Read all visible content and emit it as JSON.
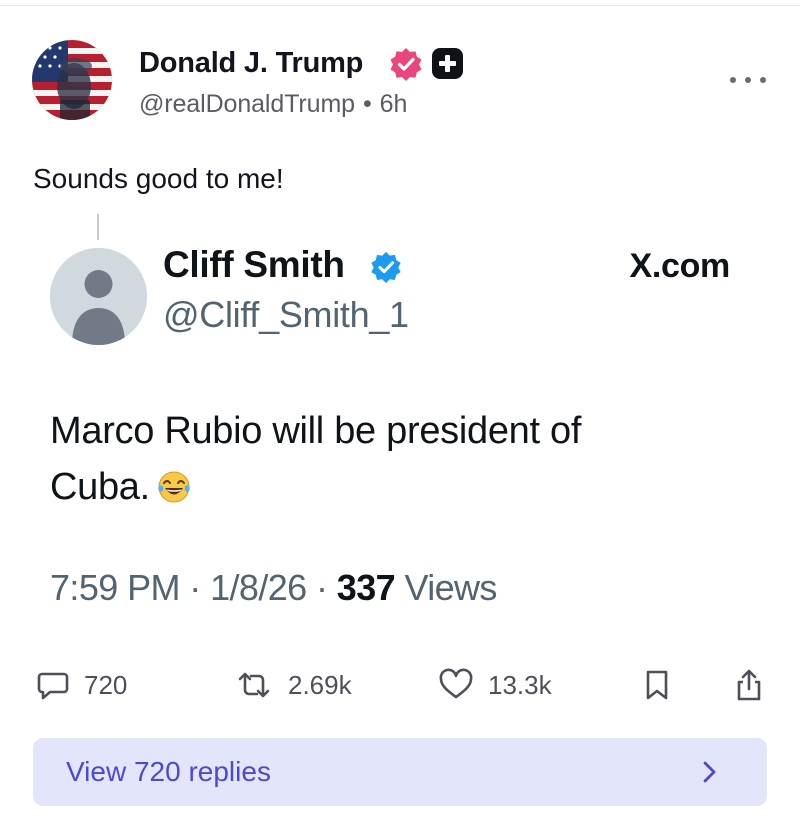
{
  "post": {
    "author_name": "Donald J. Trump",
    "handle": "@realDonaldTrump",
    "separator": "•",
    "time_ago": "6h",
    "text": "Sounds good to me!"
  },
  "quoted": {
    "name": "Cliff Smith",
    "handle": "@Cliff_Smith_1",
    "source": "X.com",
    "text": "Marco Rubio will be president of Cuba.",
    "emoji": "face-with-tears-of-joy",
    "time": "7:59 PM",
    "date": "1/8/26",
    "meta_sep": "·",
    "views_count": "337",
    "views_label": "Views"
  },
  "actions": {
    "replies": "720",
    "reposts": "2.69k",
    "likes": "13.3k"
  },
  "view_replies": {
    "label": "View 720 replies"
  },
  "colors": {
    "accent": "#4a4acf",
    "replies_bg": "#e3e5fb",
    "verified_pink": "#e8467c",
    "verified_blue": "#1d9bf0"
  }
}
